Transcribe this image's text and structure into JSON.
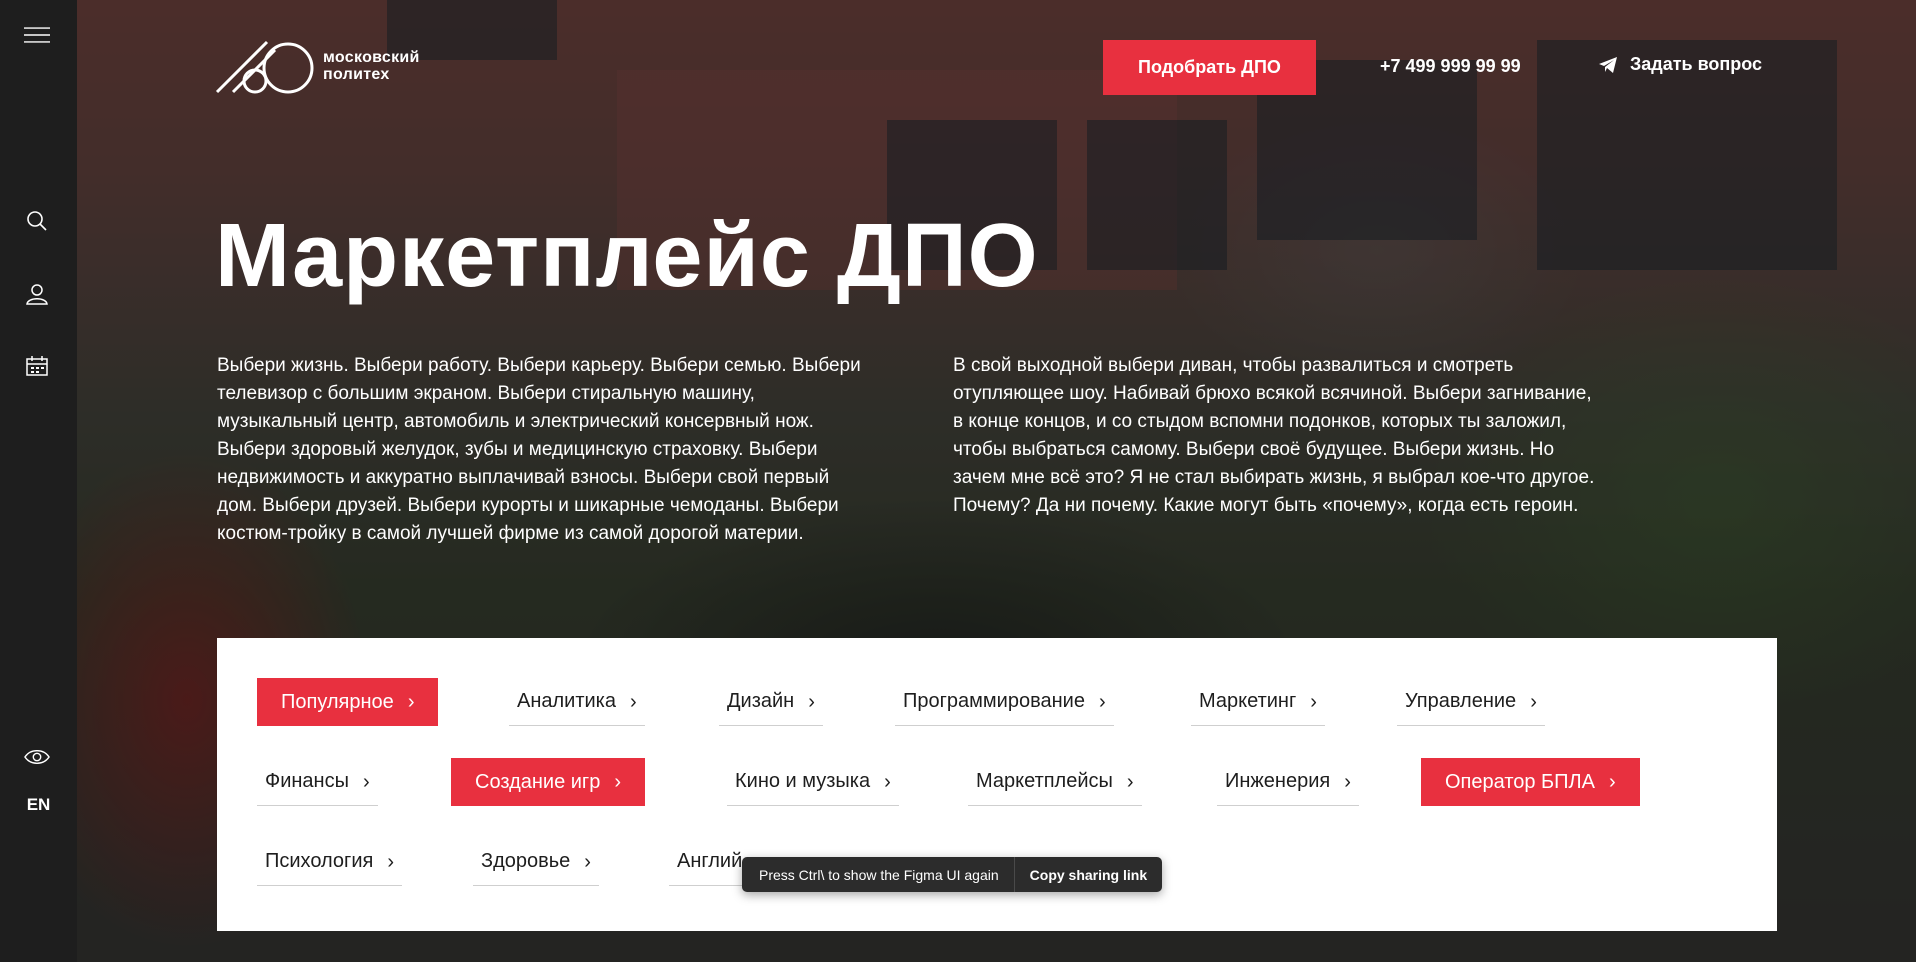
{
  "sidebar": {
    "icons": [
      "menu-icon",
      "search-icon",
      "user-icon",
      "calendar-icon",
      "eye-icon"
    ],
    "lang": "EN"
  },
  "header": {
    "logo_line1": "московский",
    "logo_line2": "политех",
    "cta": "Подобрать ДПО",
    "phone": "+7 499 999 99 99",
    "ask": "Задать вопрос"
  },
  "hero": {
    "title": "Маркетплейс ДПО",
    "para1": "Выбери жизнь. Выбери работу. Выбери карьеру. Выбери семью. Выбери телевизор с большим экраном. Выбери стиральную машину, музыкальный центр, автомобиль и электрический консервный нож. Выбери здоровый желудок, зубы и медицинскую страховку. Выбери недвижимость и аккуратно выплачивай взносы. Выбери свой первый дом. Выбери друзей. Выбери курорты и шикарные чемоданы. Выбери костюм-тройку в самой лучшей фирме из самой дорогой материи.",
    "para2": "В свой выходной выбери диван, чтобы развалиться и смотреть отупляющее шоу. Набивай брюхо всякой всячиной. Выбери загнивание, в конце концов, и со стыдом вспомни подонков, которых ты заложил, чтобы выбраться самому. Выбери своё будущее. Выбери жизнь. Но зачем мне всё это? Я не стал выбирать жизнь, я выбрал кое-что другое. Почему? Да ни почему. Какие могут быть «почему», когда есть героин."
  },
  "categories": [
    {
      "label": "Популярное",
      "active": true
    },
    {
      "label": "Аналитика",
      "active": false
    },
    {
      "label": "Дизайн",
      "active": false
    },
    {
      "label": "Программирование",
      "active": false
    },
    {
      "label": "Маркетинг",
      "active": false
    },
    {
      "label": "Управление",
      "active": false
    },
    {
      "label": "Финансы",
      "active": false
    },
    {
      "label": "Создание игр",
      "active": true
    },
    {
      "label": "Кино и музыка",
      "active": false
    },
    {
      "label": "Маркетплейсы",
      "active": false
    },
    {
      "label": "Инженерия",
      "active": false
    },
    {
      "label": "Оператор БПЛА",
      "active": true
    },
    {
      "label": "Психология",
      "active": false
    },
    {
      "label": "Здоровье",
      "active": false
    },
    {
      "label": "Англий",
      "active": false
    }
  ],
  "toast": {
    "message": "Press Ctrl\\ to show the Figma UI again",
    "link": "Copy sharing link"
  },
  "colors": {
    "accent": "#e8303f",
    "rail": "#1e1e1e"
  }
}
